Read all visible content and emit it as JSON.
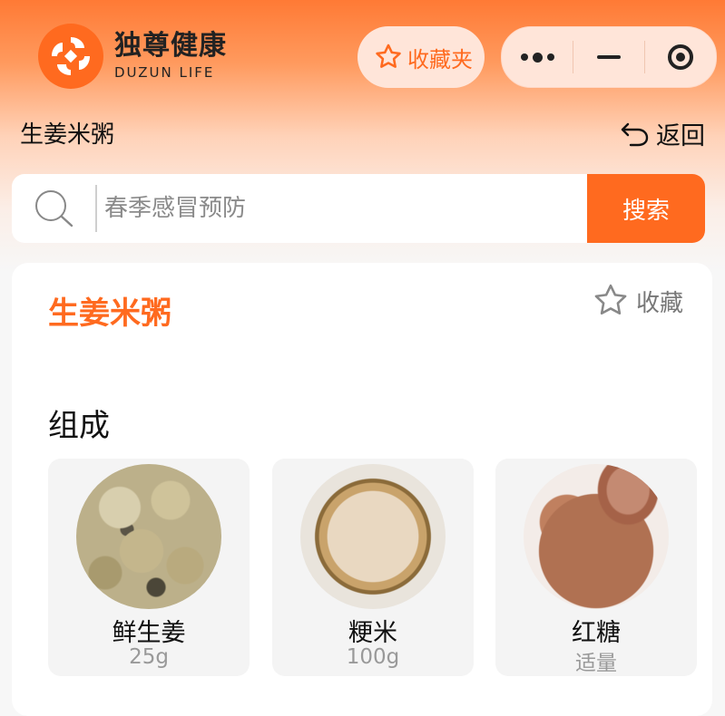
{
  "header": {
    "brand_cn": "独尊健康",
    "brand_en": "DUZUN LIFE",
    "favorites_label": "收藏夹",
    "capsule": {
      "more_icon": "more-dots-icon",
      "minimize_icon": "minimize-icon",
      "close_icon": "target-close-icon"
    }
  },
  "nav": {
    "page_title": "生姜米粥",
    "back_label": "返回"
  },
  "search": {
    "placeholder": "春季感冒预防",
    "button_label": "搜索"
  },
  "recipe": {
    "title": "生姜米粥",
    "collect_label": "收藏",
    "section_title": "组成",
    "ingredients": [
      {
        "name": "鲜生姜",
        "amount": "25g",
        "image": "ginger-image"
      },
      {
        "name": "粳米",
        "amount": "100g",
        "image": "rice-image"
      },
      {
        "name": "红糖",
        "amount": "适量",
        "image": "brown-sugar-image"
      }
    ]
  },
  "colors": {
    "accent": "#ff6a1f",
    "header_top": "#ff7a35",
    "pill_bg": "#ffe5d9"
  }
}
